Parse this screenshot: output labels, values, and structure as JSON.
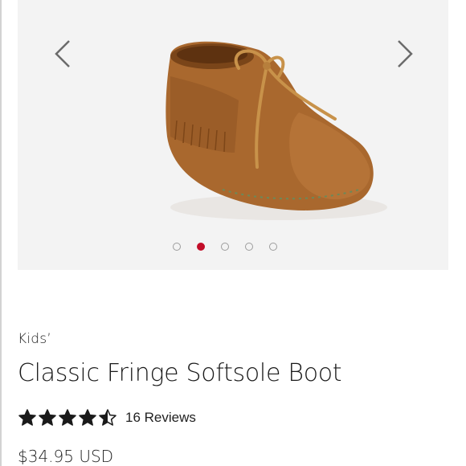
{
  "carousel": {
    "image_alt": "Brown suede fringe moccasin boot with leather lace",
    "slide_count": 5,
    "active_index": 1,
    "prev_icon": "chevron-left-icon",
    "next_icon": "chevron-right-icon"
  },
  "product": {
    "category": "Kids’",
    "title": "Classic Fringe Softsole Boot",
    "rating_value": 4.5,
    "rating_max": 5,
    "reviews_label": "16 Reviews",
    "price": "$34.95 USD"
  },
  "colors": {
    "active_dot": "#c20d28",
    "star": "#1a1a1a",
    "carousel_bg": "#f3f3f3"
  }
}
